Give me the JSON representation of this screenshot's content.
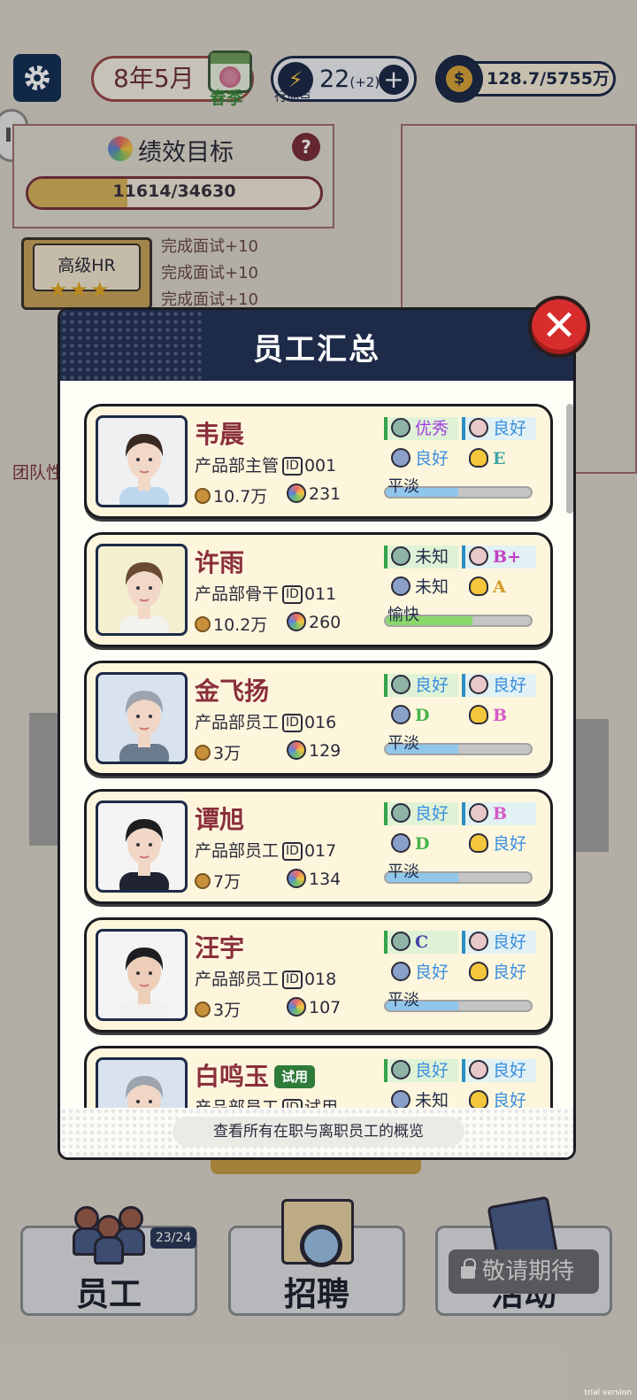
{
  "topbar": {
    "date": "8年5月",
    "season": "春季",
    "action_points": "22",
    "action_points_bonus": "(+2)",
    "action_points_label": "行动点",
    "money": "128.7/5755万",
    "settings_icon": "gear-icon"
  },
  "goal": {
    "title": "绩效目标",
    "progress_text": "11614/34630",
    "progress_fraction": 0.335
  },
  "hr_badge": {
    "label": "高级HR",
    "stars": "★★★",
    "tasks": [
      "完成面试+10",
      "完成面试+10",
      "完成面试+10"
    ]
  },
  "team_label": "团队性",
  "modal": {
    "title": "员工汇总",
    "close_label": "✕",
    "footer": "查看所有在职与离职员工的概览"
  },
  "employees": [
    {
      "name": "韦晨",
      "trial": "",
      "dept": "产品部主管",
      "id_prefix": "ID",
      "id": "001",
      "salary": "10.7万",
      "perf": "231",
      "s1": "优秀",
      "s2": "良好",
      "s3": "良好",
      "s4": "E",
      "mood": "平淡",
      "mood_fraction": 0.5
    },
    {
      "name": "许雨",
      "trial": "",
      "dept": "产品部骨干",
      "id_prefix": "ID",
      "id": "011",
      "salary": "10.2万",
      "perf": "260",
      "s1": "未知",
      "s2": "B+",
      "s3": "未知",
      "s4": "A",
      "mood": "愉快",
      "mood_fraction": 0.6
    },
    {
      "name": "金飞扬",
      "trial": "",
      "dept": "产品部员工",
      "id_prefix": "ID",
      "id": "016",
      "salary": "3万",
      "perf": "129",
      "s1": "良好",
      "s2": "良好",
      "s3": "D",
      "s4": "B",
      "mood": "平淡",
      "mood_fraction": 0.5
    },
    {
      "name": "谭旭",
      "trial": "",
      "dept": "产品部员工",
      "id_prefix": "ID",
      "id": "017",
      "salary": "7万",
      "perf": "134",
      "s1": "良好",
      "s2": "B",
      "s3": "D",
      "s4": "良好",
      "mood": "平淡",
      "mood_fraction": 0.5
    },
    {
      "name": "汪宇",
      "trial": "",
      "dept": "产品部员工",
      "id_prefix": "ID",
      "id": "018",
      "salary": "3万",
      "perf": "107",
      "s1": "C",
      "s2": "良好",
      "s3": "良好",
      "s4": "良好",
      "mood": "平淡",
      "mood_fraction": 0.5
    },
    {
      "name": "白鸣玉",
      "trial": "试用",
      "dept": "产品部员工",
      "id_prefix": "ID",
      "id": "试用",
      "salary": "",
      "perf": "",
      "s1": "良好",
      "s2": "良好",
      "s3": "未知",
      "s4": "良好",
      "mood": "",
      "mood_fraction": 0
    }
  ],
  "bottom_nav": {
    "staff_label": "员工",
    "staff_count": "23/24",
    "recruit_label": "招聘",
    "event_label": "活动",
    "locked_label": "敬请期待"
  },
  "watermark": "trial version",
  "colors": {
    "navy": "#1d2a48",
    "accent_red": "#d72d2d",
    "name_red": "#8a2f3c",
    "good_blue": "#3b8fe0",
    "excellent_purple": "#a23ee2"
  }
}
